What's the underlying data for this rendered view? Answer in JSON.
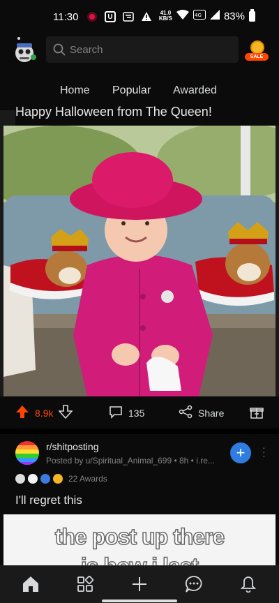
{
  "status_bar": {
    "time": "11:30",
    "network_speed_top": "41.0",
    "network_speed_bottom": "KB/S",
    "battery": "83%"
  },
  "header": {
    "search_placeholder": "Search",
    "sale_badge": "SALE"
  },
  "tabs": {
    "home": "Home",
    "popular": "Popular",
    "awarded": "Awarded"
  },
  "post1": {
    "title": "Happy Halloween from The Queen!",
    "upvotes": "8.9k",
    "comments": "135",
    "share_label": "Share"
  },
  "post2": {
    "subreddit": "r/shitposting",
    "posted_by": "Posted by u/Spiritual_Animal_699 • 8h • i.re...",
    "awards_count": "22 Awards",
    "title": "I'll regret this",
    "meme_line1": "the post up there",
    "meme_line2": "is how i last"
  },
  "colors": {
    "accent_upvote": "#ff4500",
    "tab_underline": "#4fbcff",
    "join_button": "#2f7de0"
  }
}
